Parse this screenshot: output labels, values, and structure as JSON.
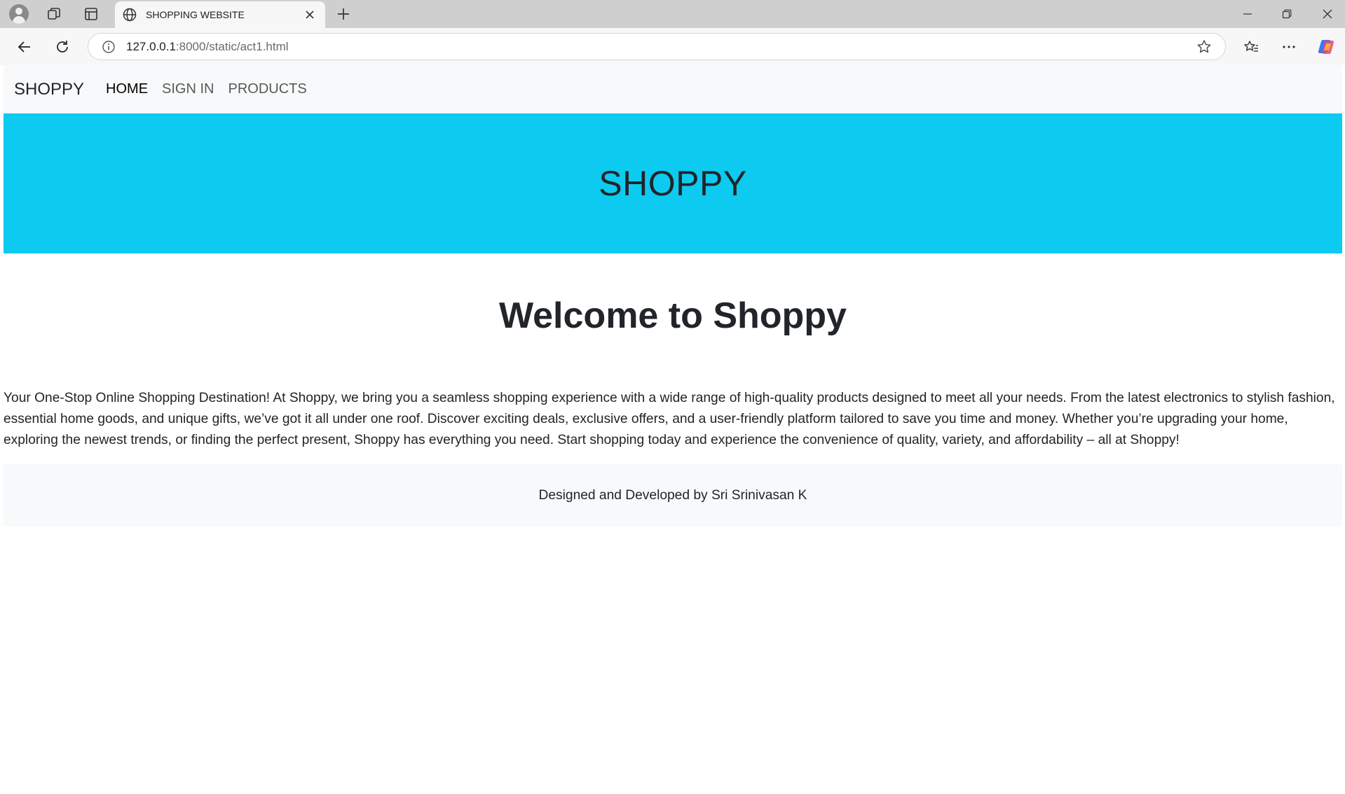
{
  "browser": {
    "tab_title": "SHOPPING WEBSITE",
    "url_host": "127.0.0.1",
    "url_rest": ":8000/static/act1.html"
  },
  "navbar": {
    "brand": "SHOPPY",
    "links": [
      "HOME",
      "SIGN IN",
      "PRODUCTS"
    ]
  },
  "hero": {
    "title": "SHOPPY",
    "background_color": "#0dcaf0"
  },
  "main": {
    "heading": "Welcome to Shoppy",
    "paragraph": "Your One-Stop Online Shopping Destination! At Shoppy, we bring you a seamless shopping experience with a wide range of high-quality products designed to meet all your needs. From the latest electronics to stylish fashion, essential home goods, and unique gifts, we’ve got it all under one roof. Discover exciting deals, exclusive offers, and a user-friendly platform tailored to save you time and money. Whether you’re upgrading your home, exploring the newest trends, or finding the perfect present, Shoppy has everything you need. Start shopping today and experience the convenience of quality, variety, and affordability – all at Shoppy!"
  },
  "footer": {
    "text": "Designed and Developed by Sri Srinivasan K"
  }
}
